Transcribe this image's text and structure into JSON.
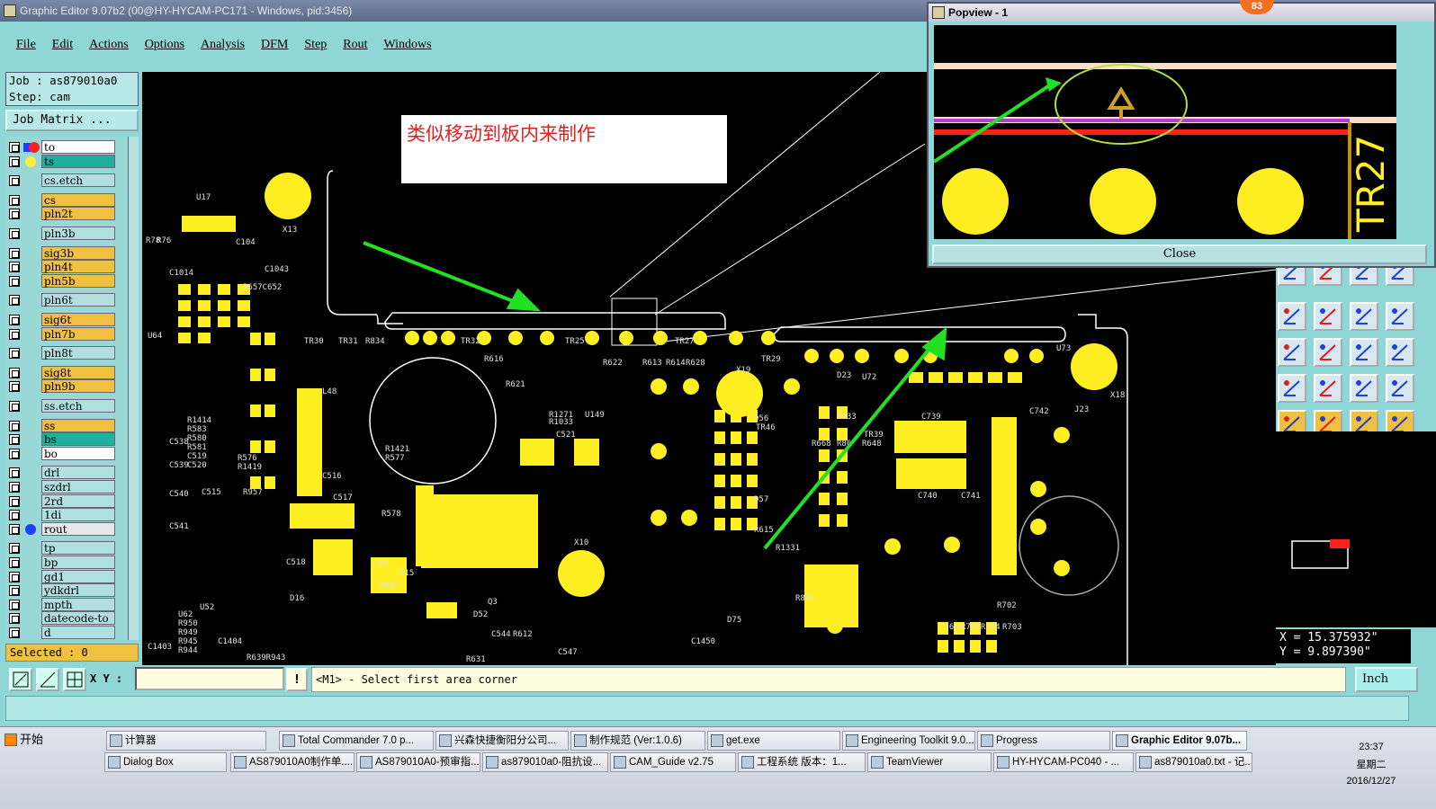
{
  "window": {
    "title": "Graphic Editor 9.07b2 (00@HY-HYCAM-PC171 - Windows, pid:3456)"
  },
  "menu": [
    "File",
    "Edit",
    "Actions",
    "Options",
    "Analysis",
    "DFM",
    "Step",
    "Rout",
    "Windows"
  ],
  "job": {
    "job_line": "Job : as879010a0",
    "step_line": "Step: cam",
    "matrix_label": "Job Matrix ..."
  },
  "layers": [
    {
      "name": "to",
      "color": "#ffffff",
      "dot": "#ff2020",
      "sq": "#2040ff"
    },
    {
      "name": "ts",
      "color": "#20b0a0",
      "dot": "#ffee40"
    },
    {
      "name": "cs.etch",
      "color": "#b0e0e0"
    },
    {
      "name": "cs",
      "color": "#f0c040"
    },
    {
      "name": "pln2t",
      "color": "#f0c040"
    },
    {
      "name": "pln3b",
      "color": "#b0e0e0"
    },
    {
      "name": "sig3b",
      "color": "#f0c040"
    },
    {
      "name": "pln4t",
      "color": "#f0c040"
    },
    {
      "name": "pln5b",
      "color": "#f0c040"
    },
    {
      "name": "pln6t",
      "color": "#b0e0e0"
    },
    {
      "name": "sig6t",
      "color": "#f0c040"
    },
    {
      "name": "pln7b",
      "color": "#f0c040"
    },
    {
      "name": "pln8t",
      "color": "#b0e0e0"
    },
    {
      "name": "sig8t",
      "color": "#f0c040"
    },
    {
      "name": "pln9b",
      "color": "#f0c040"
    },
    {
      "name": "ss.etch",
      "color": "#b0e0e0"
    },
    {
      "name": "ss",
      "color": "#f0c040"
    },
    {
      "name": "bs",
      "color": "#20b0a0"
    },
    {
      "name": "bo",
      "color": "#ffffff"
    },
    {
      "name": "drl",
      "color": "#b0e0e0"
    },
    {
      "name": "szdrl",
      "color": "#b0e0e0"
    },
    {
      "name": "2rd",
      "color": "#b0e0e0"
    },
    {
      "name": "1di",
      "color": "#b0e0e0"
    },
    {
      "name": "rout",
      "color": "#e8e8e8",
      "dot": "#2040ff"
    },
    {
      "name": "tp",
      "color": "#b0e0e0"
    },
    {
      "name": "bp",
      "color": "#b0e0e0"
    },
    {
      "name": "gd1",
      "color": "#b0e0e0"
    },
    {
      "name": "ydkdrl",
      "color": "#b0e0e0"
    },
    {
      "name": "mpth",
      "color": "#b0e0e0"
    },
    {
      "name": "datecode-to",
      "color": "#b0e0e0"
    },
    {
      "name": "d",
      "color": "#b0e0e0"
    }
  ],
  "selected": "Selected : 0",
  "canvas": {
    "annotation": "类似移动到板内来制作",
    "labels": [
      "U17",
      "X13",
      "R78",
      "R76",
      "C104",
      "C1043",
      "C1014",
      "R657C652",
      "U64",
      "TR30",
      "TR31",
      "R834",
      "TR32",
      "TR25",
      "TR27",
      "TR29",
      "R616",
      "R622",
      "R613",
      "R614",
      "R628",
      "X19",
      "D23",
      "U72",
      "U73",
      "X18",
      "R621",
      "U149",
      "R1271",
      "R1033",
      "C521",
      "D56",
      "TR46",
      "TR33",
      "C739",
      "C742",
      "J23",
      "R668",
      "R86",
      "TR39",
      "R648",
      "L48",
      "R1414",
      "R583",
      "R580",
      "R581",
      "C519",
      "C520",
      "R576",
      "R1419",
      "R1421",
      "R577",
      "C516",
      "C515",
      "R957",
      "C517",
      "R578",
      "C538",
      "C539",
      "C540",
      "C541",
      "U52",
      "C518",
      "U50",
      "D16",
      "D15",
      "R582",
      "Q3",
      "X10",
      "D52",
      "C544",
      "R612",
      "C547",
      "R631",
      "U62",
      "R950",
      "R949",
      "R945",
      "R944",
      "C1404",
      "R639R943",
      "C1403",
      "D75",
      "C1450",
      "R1331",
      "R615",
      "D57",
      "R865",
      "C566",
      "R705",
      "R704",
      "R703",
      "R702",
      "C741",
      "C740",
      "L54"
    ]
  },
  "prompt": {
    "xy_label": "X Y :",
    "message": "<M1> - Select first area corner",
    "unit": "Inch"
  },
  "coords": {
    "x": "X  =  15.375932\"",
    "y": "Y  =  9.897390\""
  },
  "popup": {
    "title": "Popview - 1",
    "close_label": "Close",
    "text": "TR27"
  },
  "badge": "83",
  "taskbar": {
    "start": "开始",
    "row1": [
      "计算器",
      "Total Commander 7.0 p...",
      "兴森快捷衡阳分公司...",
      "制作规范 (Ver:1.0.6)",
      "get.exe",
      "Engineering Toolkit 9.0...",
      "Progress",
      "Graphic Editor 9.07b..."
    ],
    "row2": [
      "Dialog Box",
      "AS879010A0制作单....",
      "AS879010A0-预审指...",
      "as879010a0-阻抗设...",
      "CAM_Guide v2.75",
      "工程系统  版本：1...",
      "TeamViewer",
      "HY-HYCAM-PC040 - ...",
      "as879010a0.txt - 记..."
    ],
    "time": "23:37",
    "weekday": "星期二",
    "date": "2016/12/27"
  }
}
